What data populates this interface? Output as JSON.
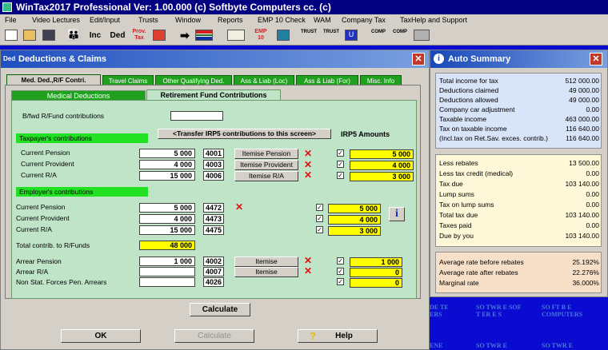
{
  "app": {
    "title": "WinTax2017 Professional Ver: 1.00.000  (c) Softbyte Computers cc. (c)"
  },
  "menu": [
    "File",
    "Video Lectures",
    "Edit/Input",
    "Trusts",
    "Window",
    "Reports",
    "EMP 10 Check",
    "WAM",
    "Company Tax",
    "TaxHelp and Support"
  ],
  "toolbar": {
    "inc": "Inc",
    "ded": "Ded",
    "prov_tax": "Prov. Tax",
    "emp10": "EMP 10",
    "trust1": "TRUST",
    "trust2": "TRUST",
    "comp1": "COMP",
    "comp2": "COMP"
  },
  "dialog": {
    "icon_text": "Ded",
    "title": "Deductions & Claims",
    "close": "✕",
    "tabs": [
      "Med. Ded.,R/F Contri.",
      "Travel Claims",
      "Other Qualifying Ded.",
      "Ass & Liab (Loc)",
      "Ass & Liab (For)",
      "Misc. Info"
    ],
    "subtabs": [
      "Medical Deductions",
      "Retirement Fund Contributions"
    ],
    "bfwd_label": "B/fwd R/Fund contributions",
    "bfwd_value": "",
    "transfer_button": "<Transfer IRP5 contributions to this screen>",
    "irp5_header": "IRP5 Amounts",
    "taxpayer_header": "Taxpayer's contributions",
    "employer_header": "Employer's contributions",
    "taxpayer_rows": [
      {
        "label": "Current Pension",
        "value": "5 000",
        "code": "4001",
        "button": "Itemise Pension",
        "irp5": "5 000"
      },
      {
        "label": "Current Provident",
        "value": "4 000",
        "code": "4003",
        "button": "Itemise Provident",
        "irp5": "4 000"
      },
      {
        "label": "Current R/A",
        "value": "15 000",
        "code": "4006",
        "button": "Itemise R/A",
        "irp5": "3 000"
      }
    ],
    "employer_rows": [
      {
        "label": "Current Pension",
        "value": "5 000",
        "code": "4472",
        "irp5": "5 000"
      },
      {
        "label": "Current Provident",
        "value": "4 000",
        "code": "4473",
        "irp5": "4 000"
      },
      {
        "label": "Current R/A",
        "value": "15 000",
        "code": "4475",
        "irp5": "3 000"
      }
    ],
    "total_label": "Total contrib. to R/Funds",
    "total_value": "48 000",
    "arrear_rows": [
      {
        "label": "Arrear Pension",
        "value": "1 000",
        "code": "4002",
        "button": "Itemise",
        "irp5": "1 000"
      },
      {
        "label": "Arrear R/A",
        "value": "",
        "code": "4007",
        "button": "Itemise",
        "irp5": "0"
      },
      {
        "label": "Non Stat. Forces Pen. Arrears",
        "value": "",
        "code": "4026",
        "irp5": "0"
      }
    ],
    "calculate_inner": "Calculate",
    "ok": "OK",
    "calculate": "Calculate",
    "help": "Help",
    "info": "i"
  },
  "summary": {
    "title": "Auto Summary",
    "close": "✕",
    "section1": [
      {
        "label": "Total income for tax",
        "value": "512 000.00"
      },
      {
        "label": "Deductions claimed",
        "value": "49 000.00"
      },
      {
        "label": "Deductions allowed",
        "value": "49 000.00"
      },
      {
        "label": "Company car adjustment",
        "value": "0.00"
      },
      {
        "label": "Taxable income",
        "value": "463 000.00"
      },
      {
        "label": "Tax on taxable income",
        "value": "116 640.00"
      },
      {
        "label": "(Incl.tax on Ret.Sav. exces. contrib.)",
        "value": "116 640.00"
      }
    ],
    "section2": [
      {
        "label": "Less rebates",
        "value": "13 500.00"
      },
      {
        "label": "Less tax credit (medical)",
        "value": "0.00"
      },
      {
        "label": "Tax due",
        "value": "103 140.00"
      },
      {
        "label": "Lump sums",
        "value": "0.00"
      },
      {
        "label": "Tax on lump sums",
        "value": "0.00"
      },
      {
        "label": "Total tax due",
        "value": "103 140.00"
      },
      {
        "label": "Taxes paid",
        "value": "0.00"
      },
      {
        "label": "Due by you",
        "value": "103 140.00"
      }
    ],
    "section3": [
      {
        "label": "Average rate before rebates",
        "value": "25.192%"
      },
      {
        "label": "Average rate after rebates",
        "value": "22.276%"
      },
      {
        "label": "Marginal rate",
        "value": "36.000%"
      }
    ]
  },
  "desktop": {
    "icon1": "DE TE ERS",
    "icon2": "SO TWR E SOF T ER E S",
    "icon3": "SO FT B E COMPUTERS",
    "icon4": "ENE",
    "icon5": "SO TWR E",
    "icon6": "SO TWR E"
  },
  "colors": {
    "title_bar": "#000080",
    "tab_green": "#1fa11f",
    "panel_green": "#c0e4c8",
    "highlight_yellow": "#ffff00",
    "header_green": "#22e022",
    "desktop_blue": "#0a0ad0",
    "summary_blue": "#d8e4f8",
    "summary_yellow": "#fff8d8",
    "summary_peach": "#f8e0c8"
  }
}
